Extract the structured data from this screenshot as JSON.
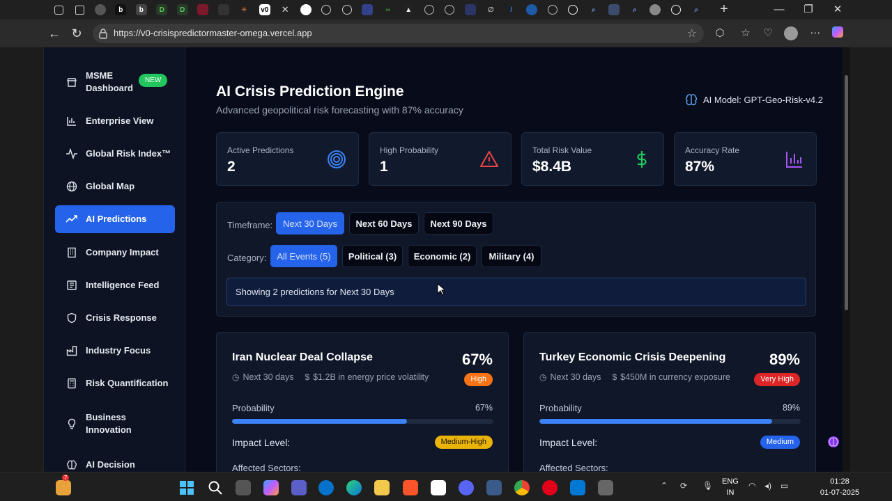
{
  "browser": {
    "url": "https://v0-crisispredictormaster-omega.vercel.app"
  },
  "sidebar": {
    "items": [
      {
        "label": "MSME Dashboard",
        "icon": "store-icon",
        "badge": "NEW"
      },
      {
        "label": "Enterprise View",
        "icon": "bar-chart-icon"
      },
      {
        "label": "Global Risk Index™",
        "icon": "activity-icon"
      },
      {
        "label": "Global Map",
        "icon": "globe-icon"
      },
      {
        "label": "AI Predictions",
        "icon": "trending-up-icon",
        "active": true
      },
      {
        "label": "Company Impact",
        "icon": "building-icon"
      },
      {
        "label": "Intelligence Feed",
        "icon": "newspaper-icon"
      },
      {
        "label": "Crisis Response",
        "icon": "shield-icon"
      },
      {
        "label": "Industry Focus",
        "icon": "factory-icon"
      },
      {
        "label": "Risk Quantification",
        "icon": "calculator-icon"
      },
      {
        "label": "Business Innovation",
        "icon": "lightbulb-icon"
      },
      {
        "label": "AI Decision",
        "icon": "brain-icon"
      }
    ]
  },
  "header": {
    "title": "AI Crisis Prediction Engine",
    "subtitle": "Advanced geopolitical risk forecasting with 87% accuracy",
    "model": "AI Model: GPT-Geo-Risk-v4.2"
  },
  "stats": [
    {
      "label": "Active Predictions",
      "value": "2",
      "icon": "target-icon",
      "color": "#3b82f6"
    },
    {
      "label": "High Probability",
      "value": "1",
      "icon": "alert-triangle-icon",
      "color": "#ef4444"
    },
    {
      "label": "Total Risk Value",
      "value": "$8.4B",
      "icon": "dollar-icon",
      "color": "#22c55e"
    },
    {
      "label": "Accuracy Rate",
      "value": "87%",
      "icon": "bar-chart-icon",
      "color": "#a855f7"
    }
  ],
  "filters": {
    "timeframe_label": "Timeframe:",
    "timeframes": [
      "Next 30 Days",
      "Next 60 Days",
      "Next 90 Days"
    ],
    "category_label": "Category:",
    "categories": [
      "All Events (5)",
      "Political (3)",
      "Economic (2)",
      "Military (4)"
    ],
    "showing": "Showing 2 predictions for Next 30 Days"
  },
  "predictions": [
    {
      "title": "Iran Nuclear Deal Collapse",
      "percent": "67%",
      "timeframe": "Next 30 days",
      "exposure": "$1.2B in energy price volatility",
      "severity": "High",
      "probability_label": "Probability",
      "probability": 0.67,
      "probability_text": "67%",
      "impact_label": "Impact Level:",
      "impact": "Medium-High",
      "sectors_label": "Affected Sectors:"
    },
    {
      "title": "Turkey Economic Crisis Deepening",
      "percent": "89%",
      "timeframe": "Next 30 days",
      "exposure": "$450M in currency exposure",
      "severity": "Very High",
      "probability_label": "Probability",
      "probability": 0.89,
      "probability_text": "89%",
      "impact_label": "Impact Level:",
      "impact": "Medium",
      "sectors_label": "Affected Sectors:"
    }
  ],
  "taskbar": {
    "lang": "ENG",
    "region": "IN",
    "time": "01:28",
    "date": "01-07-2025",
    "notification_count": "7"
  }
}
